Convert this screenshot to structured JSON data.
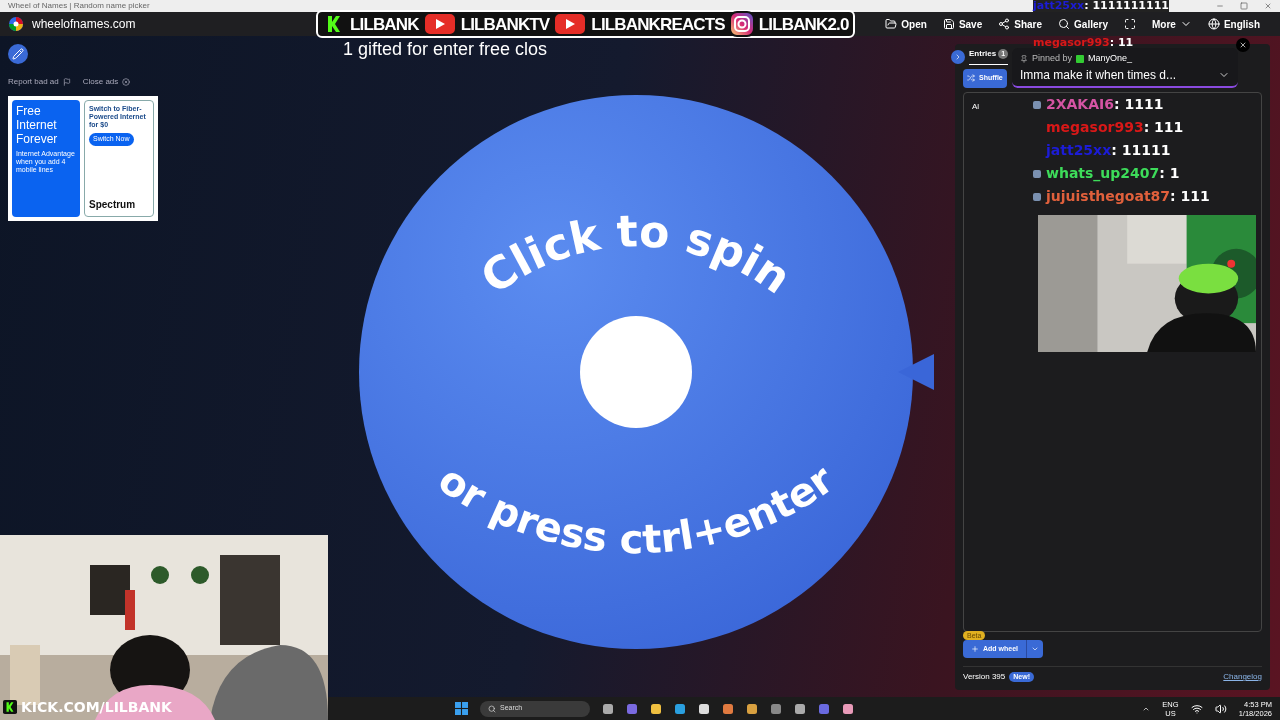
{
  "browser": {
    "tab_title": "Wheel of Names | Random name picker"
  },
  "header": {
    "site": "wheelofnames.com",
    "actions": [
      {
        "kind": "open",
        "label": "Open"
      },
      {
        "kind": "save",
        "label": "Save"
      },
      {
        "kind": "share",
        "label": "Share"
      },
      {
        "kind": "gallery",
        "label": "Gallery"
      },
      {
        "kind": "fullscreen"
      },
      {
        "kind": "more",
        "label": "More"
      },
      {
        "kind": "language",
        "label": "English"
      }
    ]
  },
  "ad_controls": {
    "report": "Report bad ad",
    "close": "Close ads"
  },
  "ad": {
    "headline": "Free Internet Forever",
    "subtext": "Internet Advantage when you add 4 mobile lines",
    "offer": "Switch to Fiber-Powered Internet for $0",
    "button": "Switch Now",
    "brand": "Spectrum"
  },
  "wheel": {
    "top_text": "Click to spin",
    "bottom_text": "or press ctrl+enter"
  },
  "panel": {
    "tabs": [
      {
        "label": "Entries",
        "count": "1",
        "selected": true
      }
    ],
    "shuffle": "Shuffle",
    "entries": [
      "Al"
    ],
    "add_wheel": "Add wheel",
    "beta": "Beta",
    "version": "Version 395",
    "new_badge": "New!",
    "changelog": "Changelog"
  },
  "stream_overlay": {
    "banner": [
      {
        "kind": "kick",
        "handle": "LILBANK"
      },
      {
        "kind": "youtube",
        "handle": "LILBANKTV"
      },
      {
        "kind": "youtube",
        "handle": "LILBANKREACTS"
      },
      {
        "kind": "instagram",
        "handle": "LILBANK2.0"
      }
    ],
    "ticker": "1 gifted for enter free clos",
    "pinned": {
      "by_label": "Pinned by",
      "user": "ManyOne_",
      "message": "Imma make it when times d..."
    },
    "chat_top": [
      {
        "user": "jatt25xx",
        "color": "#1c1cd6",
        "message": ": 1111111111"
      },
      {
        "user": "megasor993",
        "color": "#d81818",
        "message": ": 11"
      }
    ],
    "chat": [
      {
        "user": "2XAKAI6",
        "color": "#d554a3",
        "message": ": 1111",
        "badge": true
      },
      {
        "user": "megasor993",
        "color": "#d81818",
        "message": ": 111",
        "badge": false
      },
      {
        "user": "jatt25xx",
        "color": "#1c1cd6",
        "message": ": 11111",
        "badge": false
      },
      {
        "user": "whats_up2407",
        "color": "#3ddc5a",
        "message": ": 1",
        "badge": true
      },
      {
        "user": "jujuisthegoat87",
        "color": "#e0603c",
        "message": ": 111",
        "badge": true
      }
    ],
    "kick_link": "KICK.COM/LILBANK"
  },
  "taskbar": {
    "search": "Search",
    "language": [
      "ENG",
      "US"
    ],
    "time": "4:53 PM",
    "date": "1/18/2026"
  }
}
